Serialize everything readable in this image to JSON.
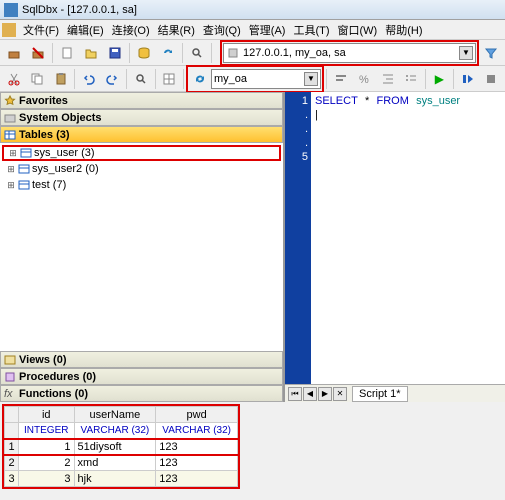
{
  "title": "SqlDbx - [127.0.0.1, sa]",
  "menu": {
    "file": "文件(F)",
    "edit": "编辑(E)",
    "connect": "连接(O)",
    "result": "结果(R)",
    "query": "查询(Q)",
    "admin": "管理(A)",
    "tools": "工具(T)",
    "window": "窗口(W)",
    "help": "帮助(H)"
  },
  "combo1": "127.0.0.1, my_oa, sa",
  "combo2": "my_oa",
  "panes": {
    "fav": "Favorites",
    "sys": "System Objects",
    "tables": "Tables (3)",
    "views": "Views (0)",
    "procs": "Procedures (0)",
    "funcs": "Functions (0)"
  },
  "tree": [
    {
      "label": "sys_user (3)",
      "hl": true
    },
    {
      "label": "sys_user2 (0)",
      "hl": false
    },
    {
      "label": "test (7)",
      "hl": false
    }
  ],
  "sql": {
    "kw1": "SELECT",
    "star": "*",
    "kw2": "FROM",
    "tbl": "sys_user"
  },
  "gutter": [
    "1",
    ".",
    ".",
    ".",
    "5"
  ],
  "script_tab": "Script 1*",
  "chart_data": {
    "type": "table",
    "columns": [
      "id",
      "userName",
      "pwd"
    ],
    "types": [
      "INTEGER",
      "VARCHAR (32)",
      "VARCHAR (32)"
    ],
    "rows": [
      {
        "n": "1",
        "id": "1",
        "userName": "51diysoft",
        "pwd": "123"
      },
      {
        "n": "2",
        "id": "2",
        "userName": "xmd",
        "pwd": "123"
      },
      {
        "n": "3",
        "id": "3",
        "userName": "hjk",
        "pwd": "123"
      }
    ]
  }
}
